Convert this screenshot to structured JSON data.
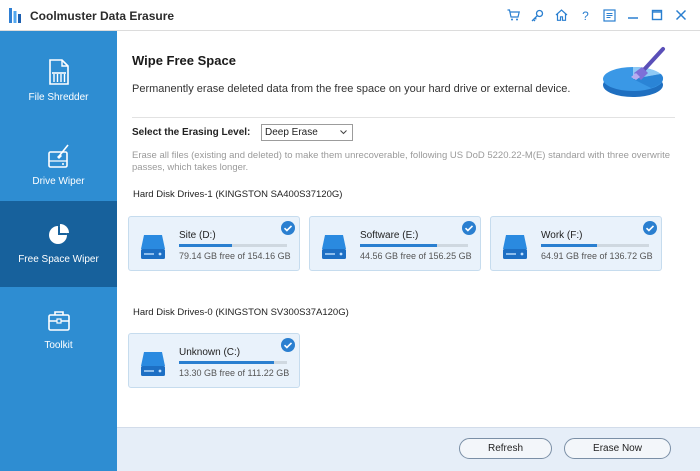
{
  "window": {
    "title": "Coolmuster Data Erasure",
    "controls": [
      {
        "name": "cart-icon",
        "glyph": "🛒"
      },
      {
        "name": "key-icon",
        "glyph": "🔑"
      },
      {
        "name": "home-icon",
        "glyph": "⌂"
      },
      {
        "name": "help-icon",
        "glyph": "?"
      },
      {
        "name": "feedback-icon",
        "glyph": "☰"
      },
      {
        "name": "minimize-icon",
        "glyph": "—"
      },
      {
        "name": "maximize-icon",
        "glyph": "☐"
      },
      {
        "name": "close-icon",
        "glyph": "✕"
      }
    ]
  },
  "sidebar": {
    "items": [
      {
        "label": "File Shredder",
        "icon": "document-icon"
      },
      {
        "label": "Drive Wiper",
        "icon": "drive-wiper-icon"
      },
      {
        "label": "Free Space Wiper",
        "icon": "pie-chart-icon",
        "active": true
      },
      {
        "label": "Toolkit",
        "icon": "toolbox-icon"
      }
    ]
  },
  "main": {
    "title": "Wipe Free Space",
    "description": "Permanently erase deleted data from the free space on your hard drive or external device.",
    "erasing_level_label": "Select the Erasing Level:",
    "erasing_level_value": "Deep Erase",
    "erasing_level_info": "Erase all files (existing and deleted) to make them unrecoverable, following US DoD 5220.22-M(E) standard with three overwrite passes, which takes longer.",
    "groups": [
      {
        "label": "Hard Disk Drives-1 (KINGSTON SA400S37120G)",
        "drives": [
          {
            "name": "Site (D:)",
            "free": "79.14 GB free of 154.16 GB",
            "free_fraction": 0.49,
            "checked": true
          },
          {
            "name": "Software (E:)",
            "free": "44.56 GB free of 156.25 GB",
            "free_fraction": 0.71,
            "checked": true
          },
          {
            "name": "Work (F:)",
            "free": "64.91 GB free of 136.72 GB",
            "free_fraction": 0.52,
            "checked": true
          }
        ]
      },
      {
        "label": "Hard Disk Drives-0 (KINGSTON SV300S37A120G)",
        "drives": [
          {
            "name": "Unknown (C:)",
            "free": "13.30 GB free of 111.22 GB",
            "free_fraction": 0.88,
            "checked": true
          }
        ]
      }
    ]
  },
  "footer": {
    "refresh_label": "Refresh",
    "erase_label": "Erase Now"
  },
  "colors": {
    "sidebar": "#2e8dd2",
    "sidebar_active": "#17619c",
    "accent": "#2a7fd0",
    "card_bg": "#e9f2fb",
    "footer_bg": "#e6eef8"
  }
}
